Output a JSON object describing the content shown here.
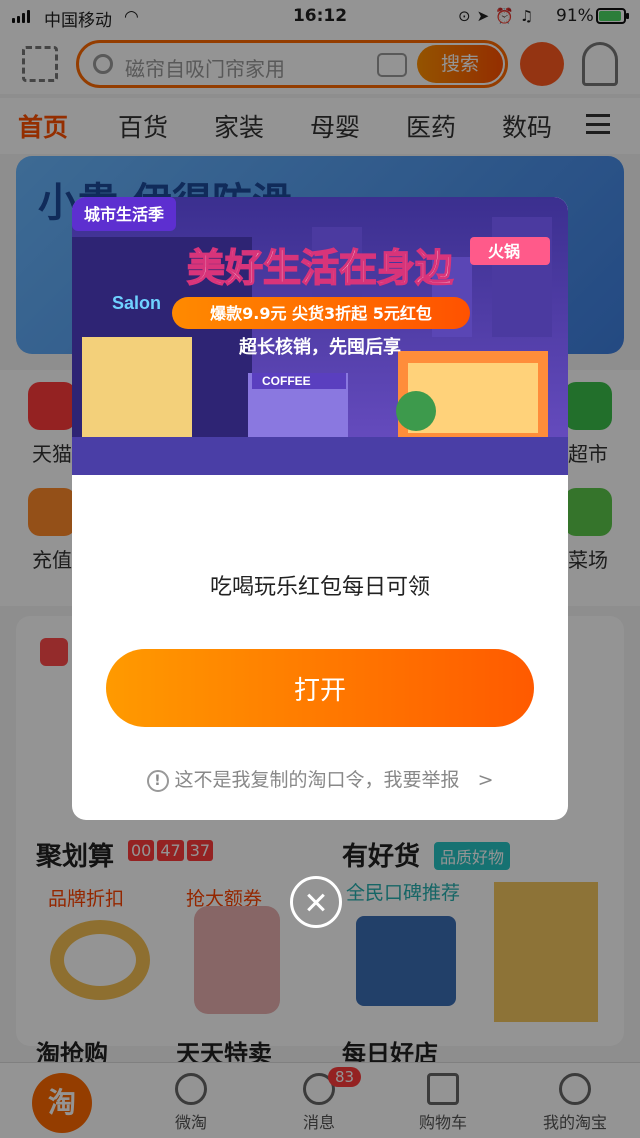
{
  "status_bar": {
    "carrier": "中国移动",
    "time": "16:12",
    "battery": "91%"
  },
  "search": {
    "placeholder": "磁帘自吸门帘家用",
    "button": "搜索"
  },
  "categories": [
    "首页",
    "百货",
    "家装",
    "母婴",
    "医药",
    "数码"
  ],
  "banner": {
    "text": "小貴 伊得防滑"
  },
  "grid": {
    "row1": [
      "天猫",
      "超市"
    ],
    "row2": [
      "充值",
      "菜场"
    ]
  },
  "feed": {
    "juhuasuan": "聚划算",
    "timer": [
      "00",
      "47",
      "37"
    ],
    "youhaohuo": "有好货",
    "youhaohuo_tag": "品质好物",
    "sub_brand": "品牌折扣",
    "sub_coupon": "抢大额券",
    "sub_word": "全民口碑推荐",
    "bottom": [
      "淘抢购",
      "天天特卖",
      "每日好店"
    ]
  },
  "tabbar": {
    "home": "淘",
    "weitao": "微淘",
    "messages": "消息",
    "messages_badge": "83",
    "cart": "购物车",
    "mine": "我的淘宝"
  },
  "modal": {
    "badge": "城市生活季",
    "headline": "美好生活在身边",
    "deals": "爆款9.9元  尖货3折起  5元红包",
    "subline": "超长核销，先囤后享",
    "shop_sign": "Salon",
    "coffee_sign": "COFFEE",
    "hotpot_sign": "火锅",
    "tagline": "吃喝玩乐红包每日可领",
    "open_button": "打开",
    "report_text": "这不是我复制的淘口令，我要举报",
    "report_arrow": ">"
  }
}
